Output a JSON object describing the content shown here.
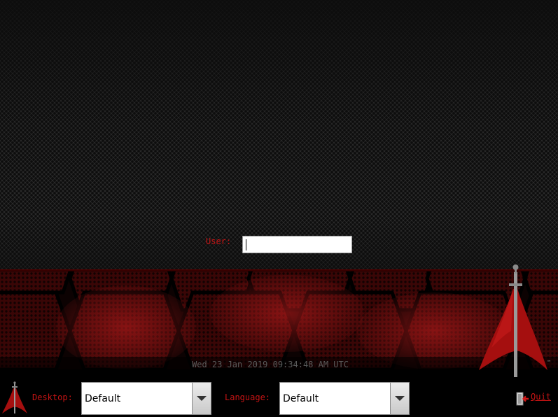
{
  "login": {
    "user_label": "User:",
    "user_value": ""
  },
  "clock": {
    "datetime": "Wed 23 Jan 2019 09:34:48 AM UTC"
  },
  "bottom_bar": {
    "desktop_label": "Desktop:",
    "desktop_value": "Default",
    "language_label": "Language:",
    "language_value": "Default",
    "quit_label": "Quit"
  },
  "branding": {
    "logo_icon": "blackarch-logo-icon",
    "trademark": "™"
  },
  "colors": {
    "accent": "#c81414",
    "clock": "#5a5a5a"
  }
}
